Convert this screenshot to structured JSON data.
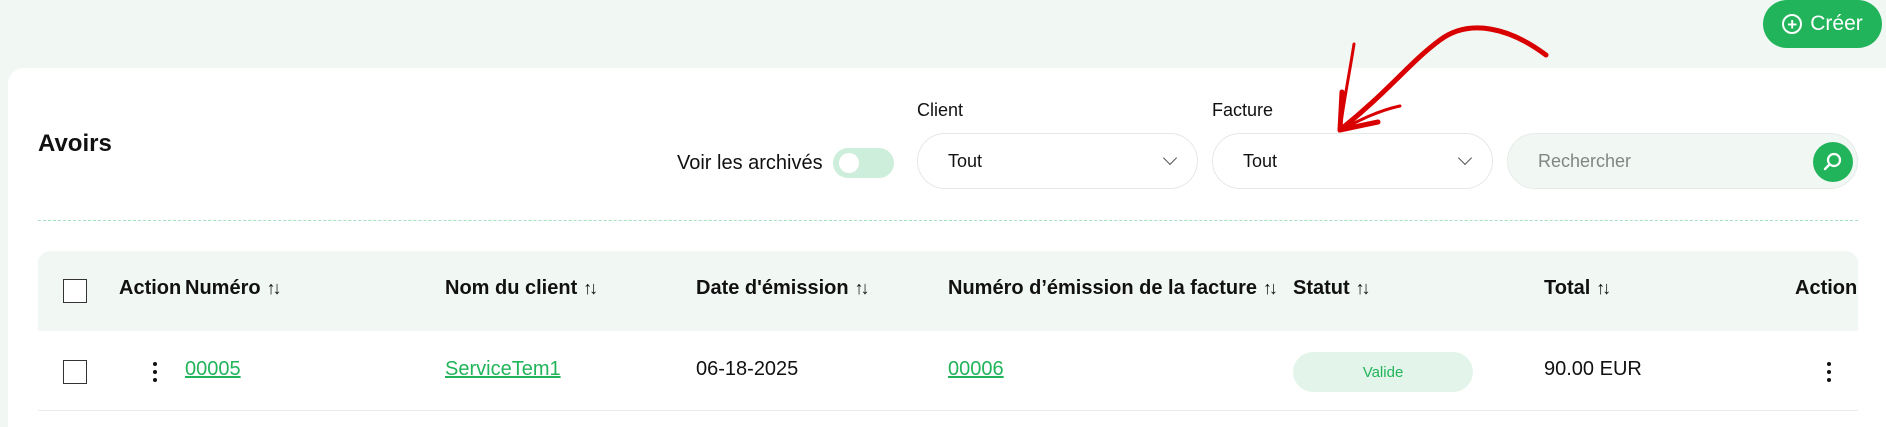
{
  "toolbar": {
    "create_label": "Créer"
  },
  "header": {
    "title": "Avoirs",
    "archive_label": "Voir les archivés",
    "archive_on": false
  },
  "filters": {
    "client": {
      "label": "Client",
      "value": "Tout"
    },
    "invoice": {
      "label": "Facture",
      "value": "Tout"
    },
    "search": {
      "placeholder": "Rechercher",
      "value": ""
    }
  },
  "table": {
    "columns": {
      "action": "Action",
      "number": "Numéro",
      "client_name": "Nom du client",
      "issue_date": "Date d'émission",
      "invoice_number": "Numéro d’émission de la facture",
      "status": "Statut",
      "total": "Total",
      "action_right": "Action"
    },
    "sort_glyph": "↑↓",
    "rows": [
      {
        "number": "00005",
        "client_name": "ServiceTem1",
        "issue_date": "06-18-2025",
        "invoice_number": "00006",
        "status": "Valide",
        "total": "90.00 EUR"
      }
    ]
  },
  "colors": {
    "accent": "#21b45a",
    "background": "#f1f7f3",
    "badge_bg": "#e3f5ea",
    "annotation": "#d90000"
  }
}
